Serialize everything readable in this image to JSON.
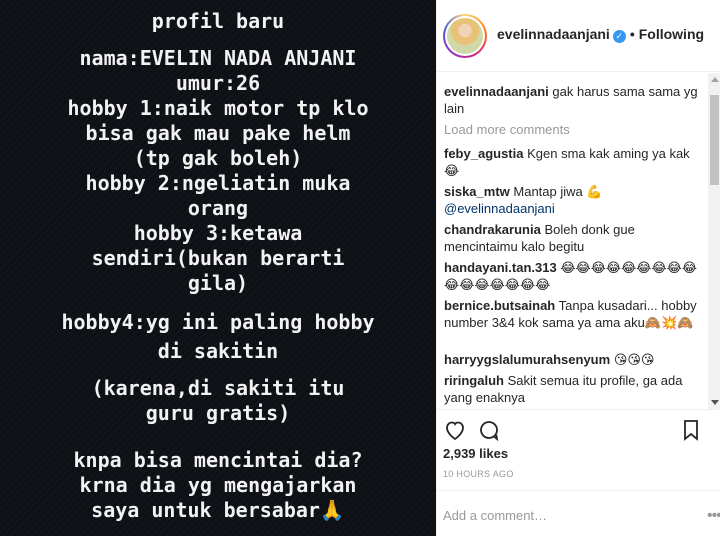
{
  "story": {
    "lines": [
      "profil baru",
      "nama:EVELIN NADA ANJANI",
      "umur:26",
      "hobby 1:naik motor tp klo",
      "bisa gak mau pake helm",
      "(tp gak boleh)",
      "hobby 2:ngeliatin muka",
      "orang",
      "hobby 3:ketawa",
      "sendiri(bukan berarti",
      "gila)",
      "hobby4:yg ini paling hobby",
      "di sakitin",
      "(karena,di sakiti itu",
      "guru gratis)",
      "knpa bisa mencintai dia?",
      "krna dia yg mengajarkan",
      "saya untuk bersabar🙏"
    ]
  },
  "header": {
    "username": "evelinnadaanjani",
    "verified_icon": "verified-badge-icon",
    "separator": "•",
    "follow_label": "Following"
  },
  "comments": {
    "load_more": "Load more comments",
    "items": [
      {
        "user": "evelinnadaanjani",
        "text": "gak harus sama sama yg lain",
        "emoji": ""
      },
      {
        "user": "feby_agustia",
        "text": "Kgen sma kak aming ya kak",
        "emoji": "😂"
      },
      {
        "user": "siska_mtw",
        "text": "Mantap jiwa 💪",
        "mention": "@evelinnadaanjani",
        "emoji": ""
      },
      {
        "user": "chandrakarunia",
        "text": "Boleh donk gue mencintaimu kalo begitu",
        "emoji": ""
      },
      {
        "user": "handayani.tan.313",
        "text": "😂😂😂😂😂😂😂😂😂😂😂😂😂😂😂😂",
        "emoji": ""
      },
      {
        "user": "bernice.butsainah",
        "text": "Tanpa kusadari... hobby number 3&4 kok sama ya ama aku🙈💥🙈",
        "emoji": ""
      },
      {
        "user": "harryygslalumurahsenyum",
        "text": "😘😘😘",
        "emoji": ""
      },
      {
        "user": "riringaluh",
        "text": "Sakit semua itu profile, ga ada yang enaknya",
        "emoji": ""
      }
    ]
  },
  "actions": {
    "like_icon": "heart-icon",
    "comment_icon": "comment-icon",
    "save_icon": "bookmark-icon"
  },
  "likes": "2,939 likes",
  "timestamp": "10 HOURS AGO",
  "add_comment": {
    "placeholder": "Add a comment…",
    "more_label": "•••"
  }
}
